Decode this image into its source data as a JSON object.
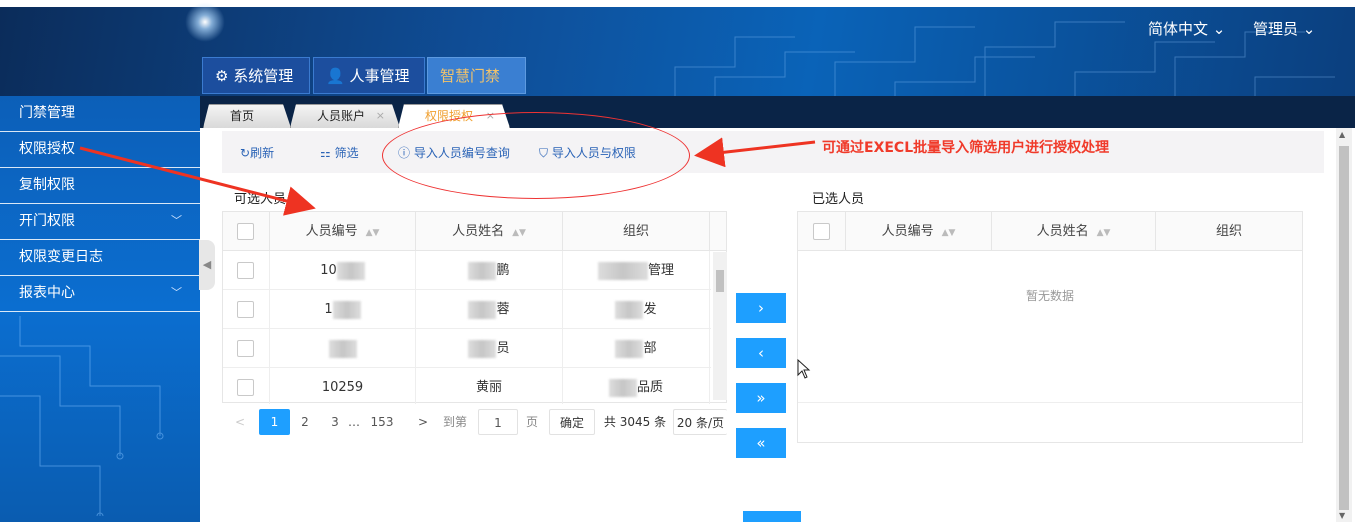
{
  "header": {
    "language": "简体中文",
    "user": "管理员",
    "modules": [
      {
        "label": "系统管理",
        "icon": "gear-icon"
      },
      {
        "label": "人事管理",
        "icon": "user-icon"
      },
      {
        "label": "智慧门禁"
      }
    ]
  },
  "sidebar": {
    "items": [
      {
        "label": "门禁管理"
      },
      {
        "label": "权限授权"
      },
      {
        "label": "复制权限"
      },
      {
        "label": "开门权限",
        "expandable": true
      },
      {
        "label": "权限变更日志"
      },
      {
        "label": "报表中心",
        "expandable": true
      }
    ]
  },
  "page_tabs": [
    {
      "label": "首页"
    },
    {
      "label": "人员账户"
    },
    {
      "label": "权限授权",
      "active": true
    }
  ],
  "toolbar": {
    "refresh": "刷新",
    "filter": "筛选",
    "import_query": "导入人员编号查询",
    "import_auth": "导入人员与权限"
  },
  "annotation": "可通过EXECL批量导入筛选用户进行授权处理",
  "available": {
    "title": "可选人员",
    "columns": [
      "人员编号",
      "人员姓名",
      "组织"
    ],
    "rows": [
      {
        "id": "10",
        "name": "鹏",
        "org": "管理"
      },
      {
        "id": "1",
        "name": "蓉",
        "org": "发"
      },
      {
        "id": "",
        "name": "员",
        "org": "部"
      },
      {
        "id": "10259",
        "name": "黄丽",
        "org": "品质"
      }
    ]
  },
  "selected": {
    "title": "已选人员",
    "columns": [
      "人员编号",
      "人员姓名",
      "组织"
    ],
    "empty_text": "暂无数据"
  },
  "transfer": {
    "right": "›",
    "left": "‹",
    "all_right": "»",
    "all_left": "«"
  },
  "pagination": {
    "current": "1",
    "pages": [
      "2",
      "3"
    ],
    "ellipsis": "…",
    "last": "153",
    "goto_label": "到第",
    "goto_value": "1",
    "page_unit": "页",
    "confirm": "确定",
    "total": "共 3045 条",
    "page_size": "20 条/页"
  }
}
